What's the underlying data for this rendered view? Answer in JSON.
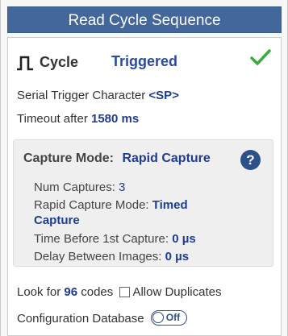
{
  "header": {
    "title": "Read Cycle Sequence"
  },
  "cycle": {
    "label": "Cycle",
    "value": "Triggered",
    "icon": "pulse-icon",
    "status_icon": "checkmark-icon"
  },
  "serial_trigger": {
    "label": "Serial Trigger Character ",
    "value": "<SP>"
  },
  "timeout": {
    "label": "Timeout after ",
    "value": "1580 ms"
  },
  "capture": {
    "title": "Capture Mode:",
    "mode": "Rapid Capture",
    "help": "?",
    "num_captures_label": "Num Captures: ",
    "num_captures_value": "3",
    "rapid_mode_label": "Rapid Capture Mode: ",
    "rapid_mode_value_1": "Timed",
    "rapid_mode_value_2": "Capture",
    "time_before_label": "Time Before 1st Capture: ",
    "time_before_value": "0 µs",
    "delay_label": "Delay Between Images: ",
    "delay_value": "0 µs"
  },
  "look_for": {
    "prefix": "Look for ",
    "count": "96",
    "suffix": " codes",
    "allow_duplicates_label": "Allow Duplicates",
    "allow_duplicates_checked": false
  },
  "config_db": {
    "label": "Configuration Database",
    "toggle_label": "Off"
  },
  "colors": {
    "header_bg": "#44679b",
    "value_text": "#1f3c93",
    "check_green": "#3caa3c"
  }
}
